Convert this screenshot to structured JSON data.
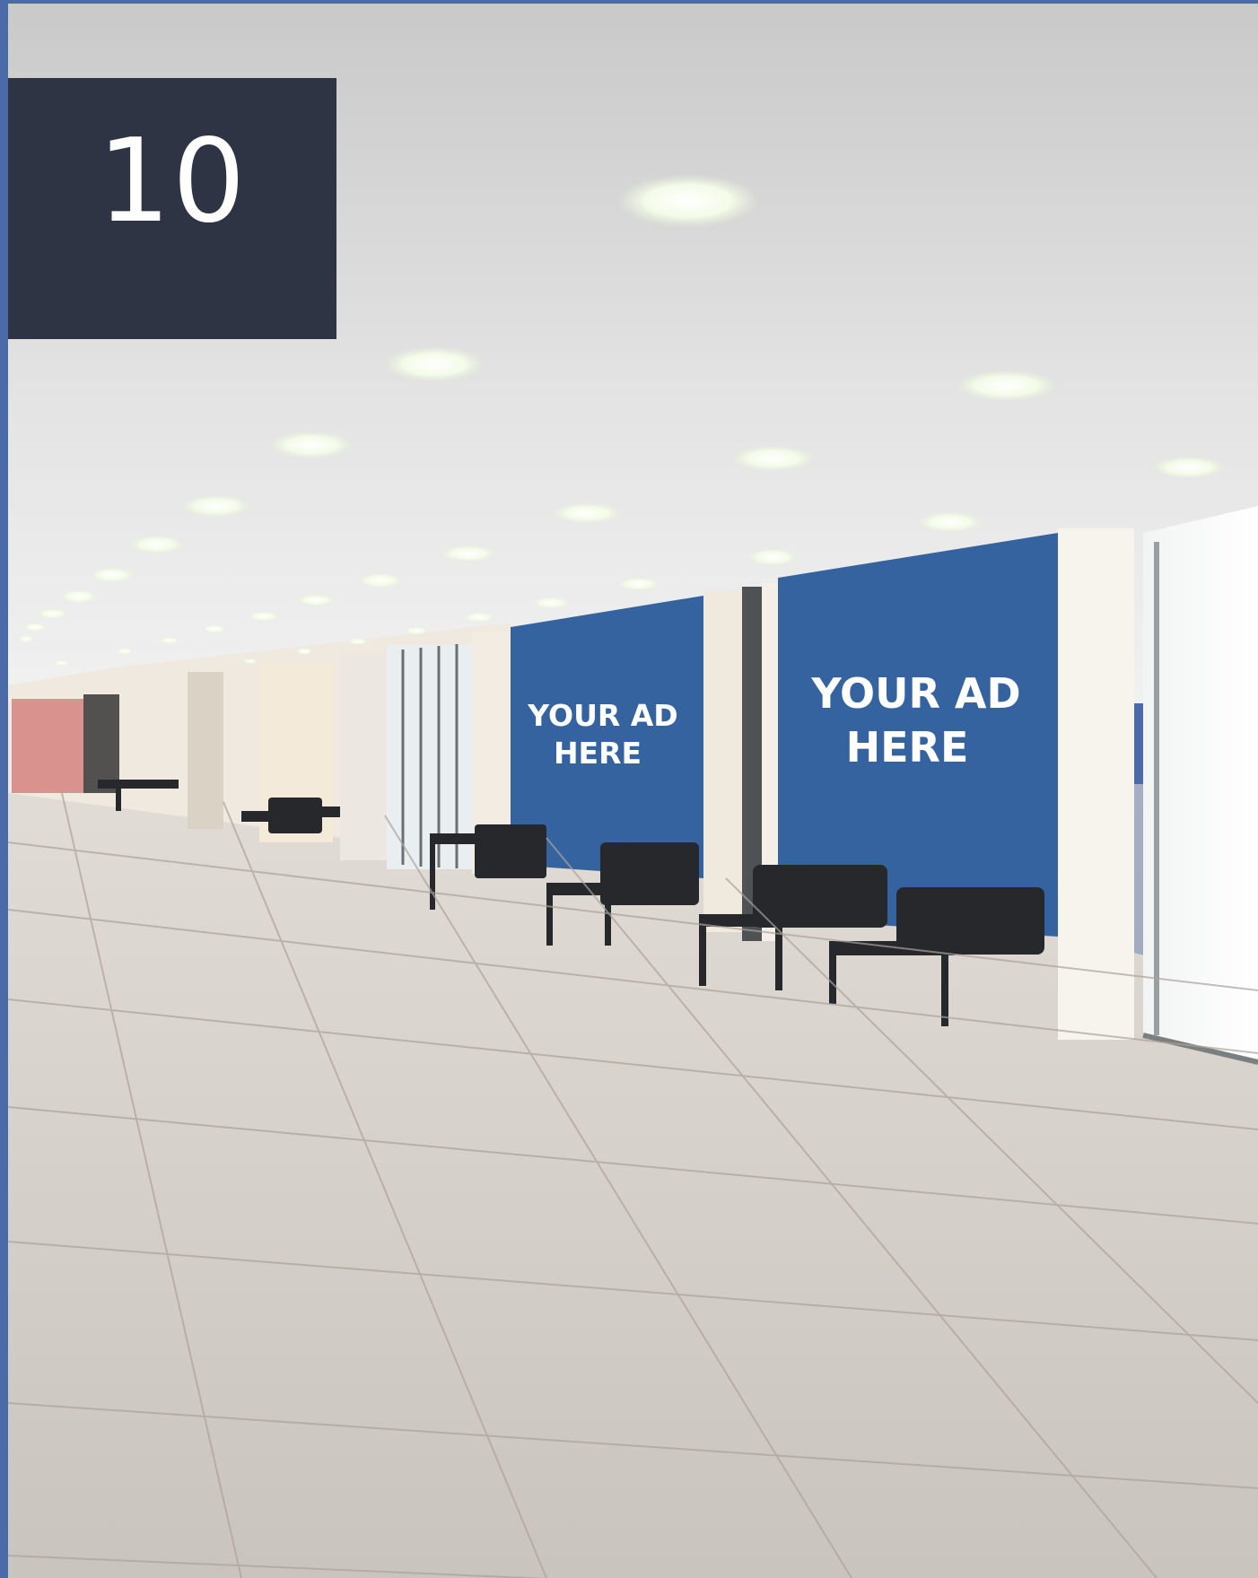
{
  "badge": {
    "number": "10"
  },
  "ads": [
    {
      "line1": "YOUR AD",
      "line2": "HERE"
    },
    {
      "line1": "YOUR AD",
      "line2": "HERE"
    }
  ],
  "colors": {
    "frame": "#4a6aa8",
    "badge_bg": "#2e3444",
    "ad_panel": "#3563a0",
    "ceiling": "#d9d9d9",
    "floor": "#cfcac3"
  }
}
